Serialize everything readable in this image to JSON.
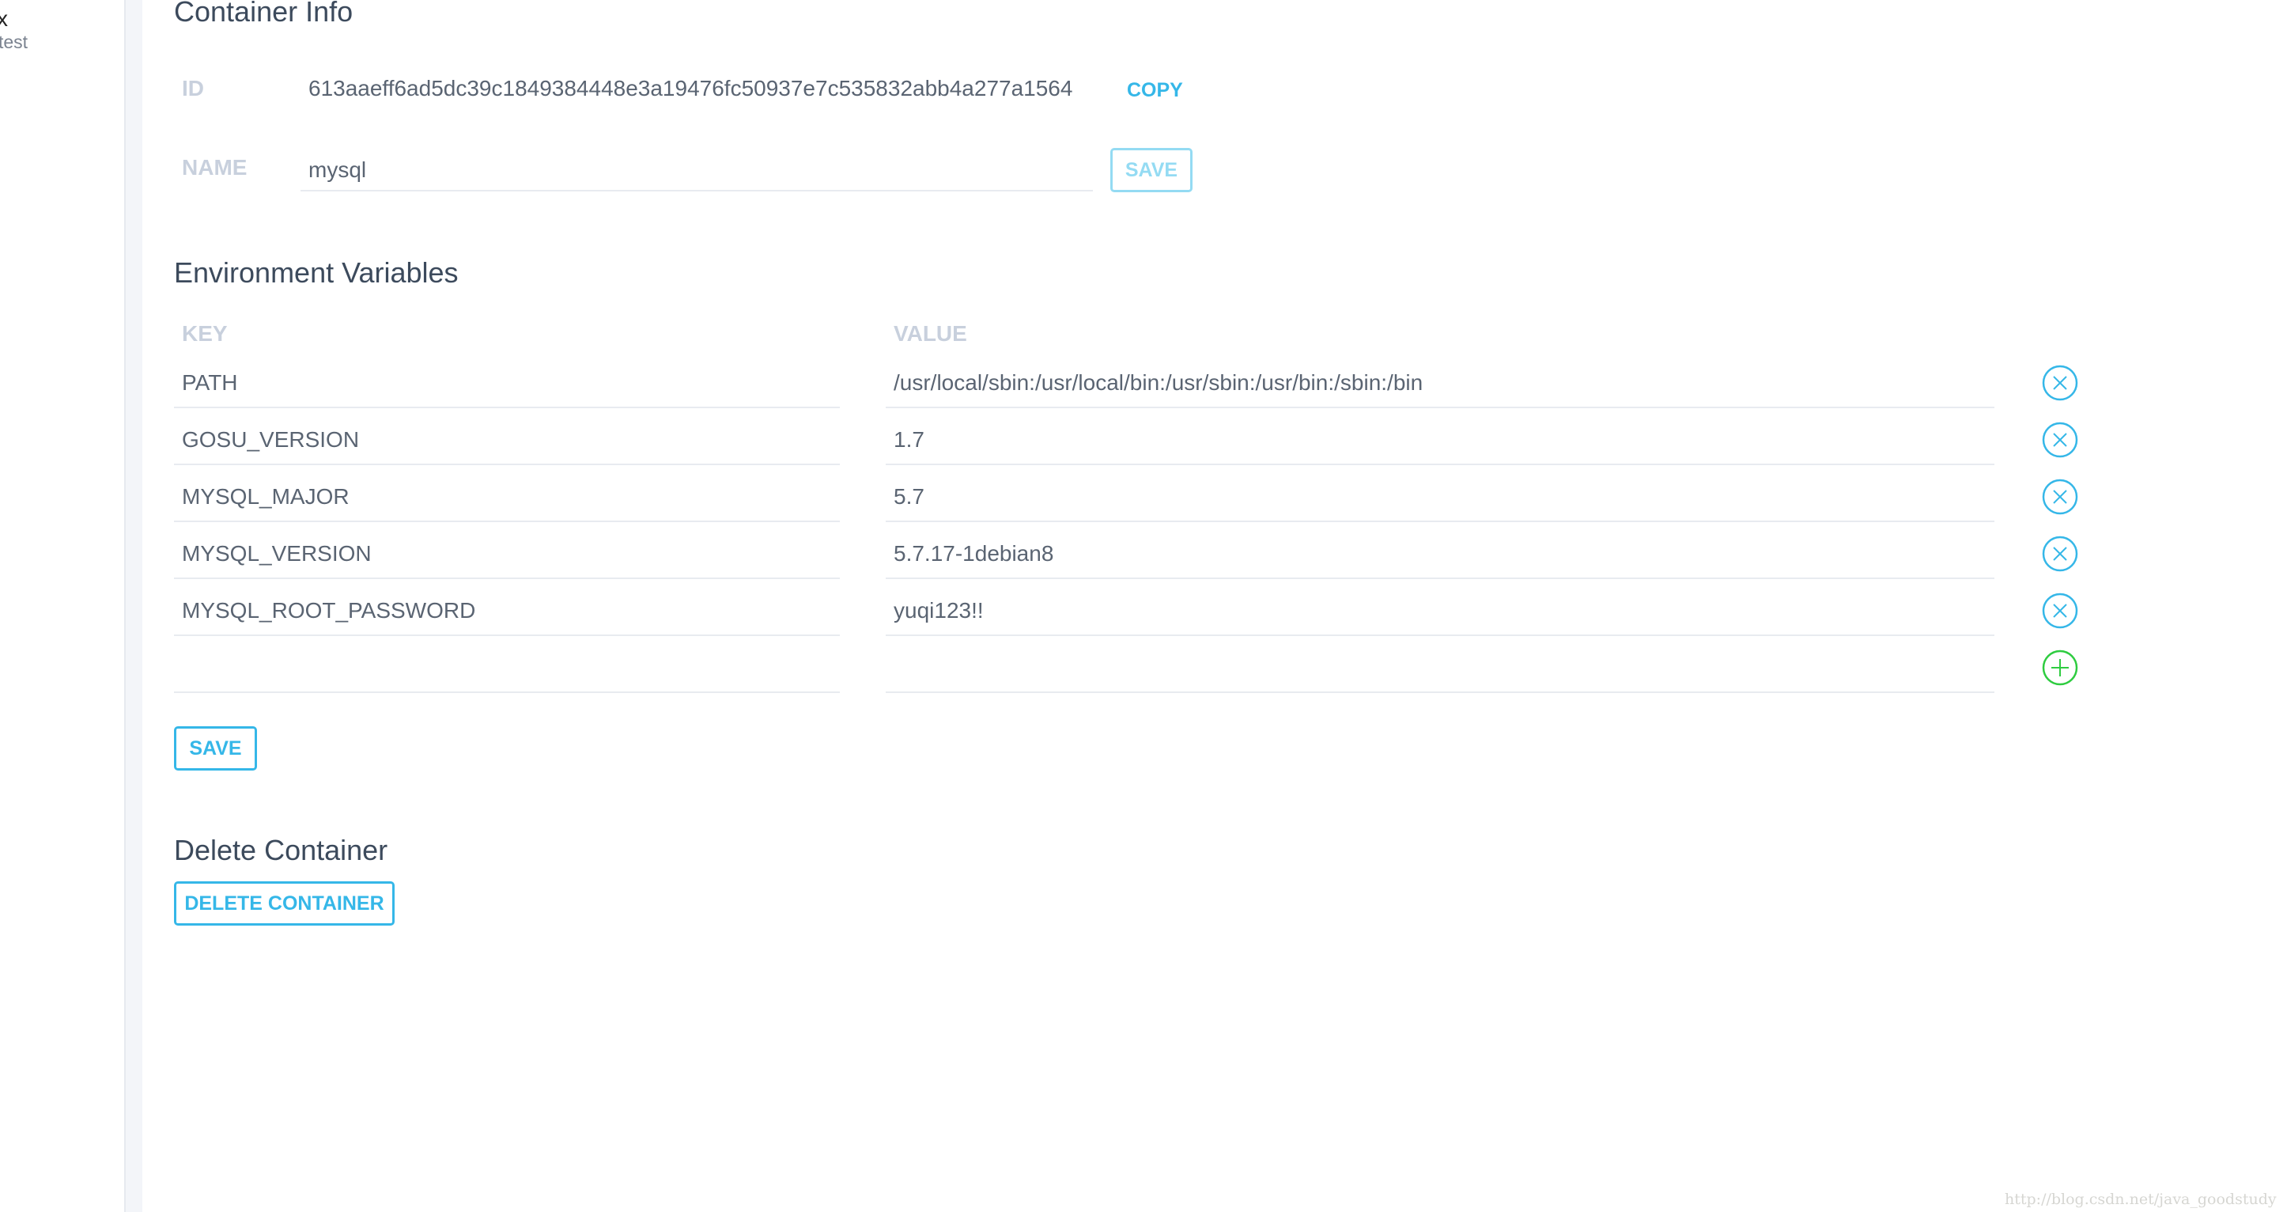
{
  "sidebar": {
    "item_title": "x",
    "item_subtitle": "test"
  },
  "container_info": {
    "heading": "Container Info",
    "id_label": "ID",
    "id_value": "613aaeff6ad5dc39c1849384448e3a19476fc50937e7c535832abb4a277a1564",
    "copy_label": "COPY",
    "name_label": "NAME",
    "name_value": "mysql",
    "save_label": "SAVE"
  },
  "env": {
    "heading": "Environment Variables",
    "key_header": "KEY",
    "value_header": "VALUE",
    "rows": [
      {
        "key": "PATH",
        "value": "/usr/local/sbin:/usr/local/bin:/usr/sbin:/usr/bin:/sbin:/bin"
      },
      {
        "key": "GOSU_VERSION",
        "value": "1.7"
      },
      {
        "key": "MYSQL_MAJOR",
        "value": "5.7"
      },
      {
        "key": "MYSQL_VERSION",
        "value": "5.7.17-1debian8"
      },
      {
        "key": "MYSQL_ROOT_PASSWORD",
        "value": "yuqi123!!"
      }
    ],
    "new_row": {
      "key": "",
      "value": ""
    },
    "save_label": "SAVE"
  },
  "delete": {
    "heading": "Delete Container",
    "button_label": "DELETE CONTAINER"
  },
  "watermark": "http://blog.csdn.net/java_goodstudy",
  "colors": {
    "accent": "#35b7e8",
    "add": "#2ecc40",
    "heading": "#3c4a5c",
    "label": "#c8d0dd"
  }
}
